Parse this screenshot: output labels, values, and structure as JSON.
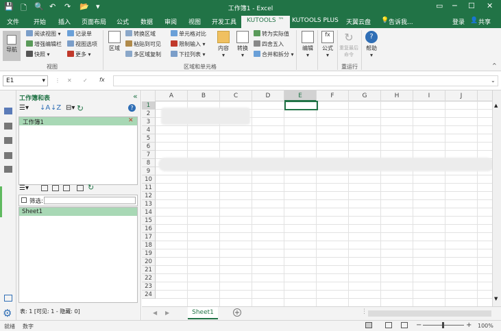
{
  "window": {
    "title": "工作簿1 - Excel",
    "controls": [
      "▭",
      "─",
      "☐",
      "✕"
    ]
  },
  "quick_access": [
    "save-icon",
    "new-icon",
    "print-preview-icon",
    "undo-icon",
    "redo-icon",
    "open-icon"
  ],
  "tabs": [
    "文件",
    "开始",
    "插入",
    "页面布局",
    "公式",
    "数据",
    "审阅",
    "视图",
    "开发工具",
    "KUTOOLS ™",
    "KUTOOLS PLUS",
    "天翼云盘"
  ],
  "active_tab": "KUTOOLS ™",
  "tell_me": "告诉我...",
  "signin": "登录",
  "share": "共享",
  "ribbon": {
    "nav_label": "导航",
    "view_items": [
      "阅读视图",
      "记录单",
      "增强编辑栏",
      "视图选项",
      "快照",
      "更多"
    ],
    "view_group": "视图",
    "range_big": [
      "区域",
      "转换区域",
      "粘贴到可见",
      "多区域复制"
    ],
    "range_items": [
      "单元格对比",
      "限制输入",
      "下拉列表",
      "转为实际值",
      "四舍五入",
      "合并和拆分"
    ],
    "content_label": "内容",
    "convert_label": "转换",
    "range_group": "区域和单元格",
    "edit_label": "编辑",
    "formula_label": "公式",
    "rerun_label": "重复最后命令",
    "rerun_group": "重运行",
    "help_label": "帮助"
  },
  "formula_bar": {
    "name_box": "E1",
    "fx": "fx",
    "value": ""
  },
  "panel": {
    "title": "工作簿和表",
    "workbook": "工作簿1",
    "filter_label": "筛选:",
    "sheet_item": "Sheet1",
    "footer": "表: 1 [可见: 1 - 隐藏: 0]"
  },
  "grid": {
    "columns": [
      "A",
      "B",
      "C",
      "D",
      "E",
      "F",
      "G",
      "H",
      "I",
      "J"
    ],
    "rows": [
      "1",
      "2",
      "3",
      "4",
      "5",
      "6",
      "7",
      "8",
      "9",
      "10",
      "11",
      "12",
      "13",
      "14",
      "15",
      "16",
      "17",
      "18",
      "19",
      "20",
      "21",
      "22",
      "23",
      "24"
    ],
    "selected_cell": "E1"
  },
  "sheet_tab": "Sheet1",
  "status": {
    "left": "就绪",
    "mode": "数字",
    "zoom": "100%"
  },
  "colors": {
    "brand": "#217346",
    "selection": "#a8d8b5"
  }
}
